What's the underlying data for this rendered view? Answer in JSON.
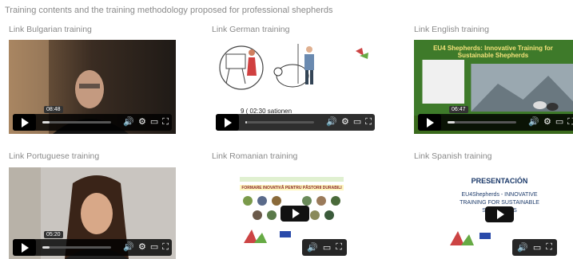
{
  "intro": "Training contents and the training methodology proposed for professional shepherds",
  "trainings": [
    {
      "label": "Link Bulgarian training",
      "time": "08:48",
      "progress": 0.1
    },
    {
      "label": "Link German training",
      "time": "02:30",
      "caption_fragment": "9 ( 02:30 sationen",
      "progress": 0.0
    },
    {
      "label": "Link English training",
      "time": "06:47",
      "thumb_title": "EU4 Shepherds: Innovative Training for Sustainable Shepherds",
      "progress": 0.1
    },
    {
      "label": "Link Portuguese training",
      "time": "05:20",
      "progress": 0.1
    },
    {
      "label": "Link Romanian training",
      "thumb_title": "FORMARE INOVATIVĂ PENTRU PĂSTORII DURABILI"
    },
    {
      "label": "Link Spanish training",
      "thumb_title": "PRESENTACIÓN",
      "thumb_subtitle": "EU4Shepherds - INNOVATIVE TRAINING FOR SUSTAINABLE SHEPHERDS"
    }
  ],
  "icons": {
    "play": "play-icon",
    "volume": "volume-icon",
    "settings": "gear-icon",
    "pip": "picture-in-picture-icon",
    "fullscreen": "fullscreen-icon"
  }
}
